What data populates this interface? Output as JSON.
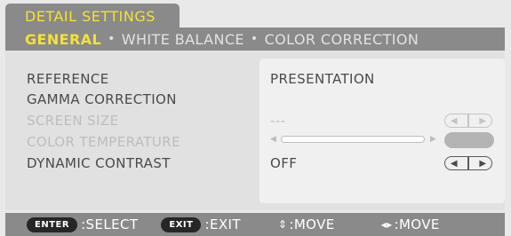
{
  "window": {
    "title": "DETAIL SETTINGS"
  },
  "tabs": [
    {
      "label": "GENERAL",
      "active": true
    },
    {
      "label": "WHITE BALANCE",
      "active": false
    },
    {
      "label": "COLOR CORRECTION",
      "active": false
    }
  ],
  "tab_separator": "•",
  "settings": [
    {
      "label": "REFERENCE",
      "value": "PRESENTATION",
      "enabled": true
    },
    {
      "label": "GAMMA CORRECTION",
      "value": "",
      "enabled": true
    },
    {
      "label": "SCREEN SIZE",
      "value": "---",
      "enabled": false
    },
    {
      "label": "COLOR TEMPERATURE",
      "value": "",
      "enabled": false
    },
    {
      "label": "DYNAMIC CONTRAST",
      "value": "OFF",
      "enabled": true
    }
  ],
  "footer": {
    "enter_key": "ENTER",
    "enter_label": ":SELECT",
    "exit_key": "EXIT",
    "exit_label": ":EXIT",
    "move_vertical_label": ":MOVE",
    "move_horizontal_label": ":MOVE"
  },
  "colors": {
    "accent": "#f4e233",
    "bar": "#8a8a8a",
    "text": "#4a4a4a",
    "disabled": "#bdbdbd"
  }
}
